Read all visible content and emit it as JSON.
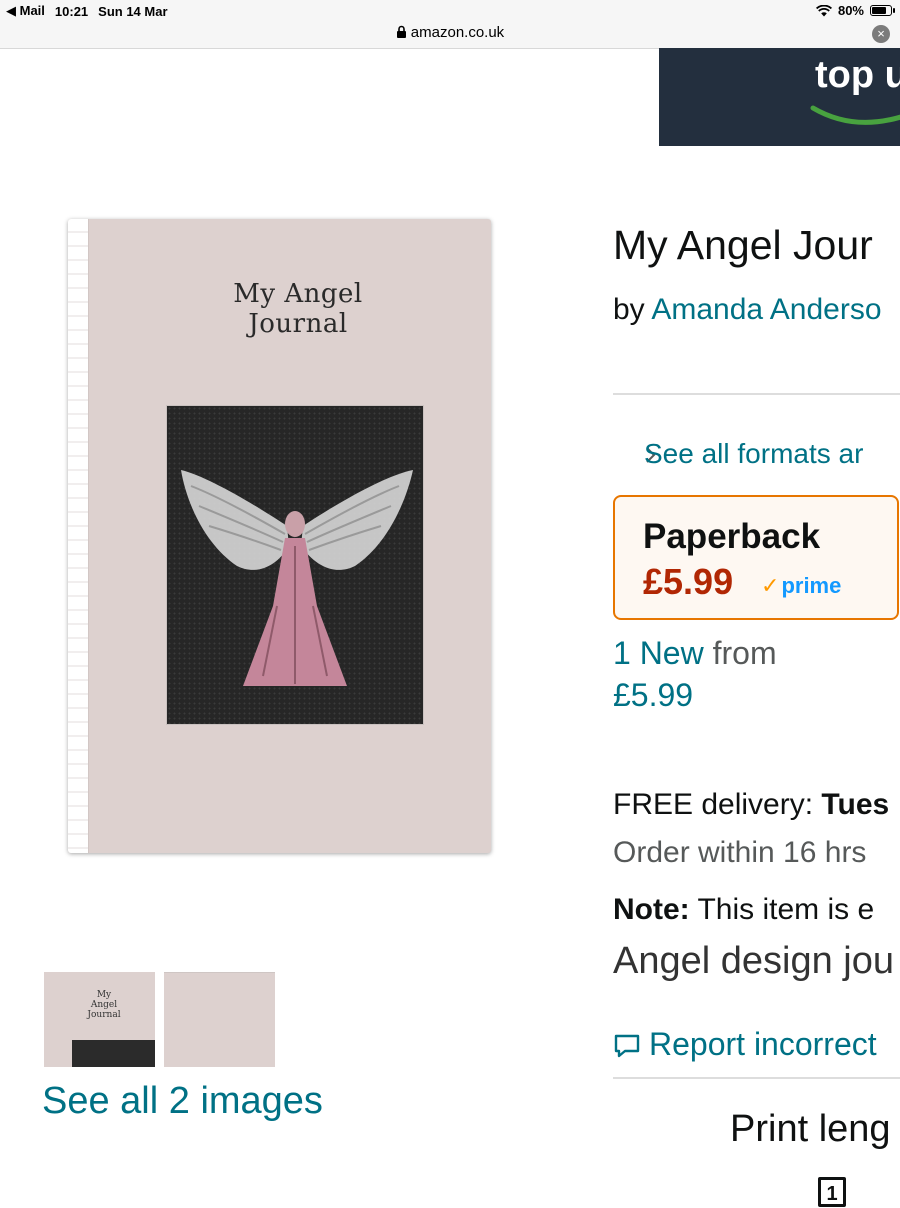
{
  "status_bar": {
    "back_app": "Mail",
    "time": "10:21",
    "date": "Sun 14 Mar",
    "battery": "80%",
    "battery_level": 0.8
  },
  "browser": {
    "domain": "amazon.co.uk"
  },
  "banner": {
    "text": "top u"
  },
  "product": {
    "cover_title": "My Angel Journal",
    "title": "My Angel Jour",
    "by_label": "by",
    "author": "Amanda Anderso",
    "see_all_formats": "See all formats ar",
    "format": {
      "name": "Paperback",
      "price": "£5.99",
      "prime": "prime"
    },
    "offers": {
      "new_link": "1 New",
      "from": "from",
      "price": "£5.99"
    },
    "delivery": {
      "label": "FREE delivery:",
      "day": "Tues"
    },
    "order_within": "Order within 16 hrs",
    "note": {
      "label": "Note:",
      "text": "This item is e"
    },
    "description": "Angel design jou",
    "report_link": "Report incorrect",
    "print_length_label": "Print leng",
    "pages_icon_number": "1"
  },
  "gallery": {
    "thumb1_title": "My Angel Journal",
    "see_all_images": "See all 2 images"
  }
}
